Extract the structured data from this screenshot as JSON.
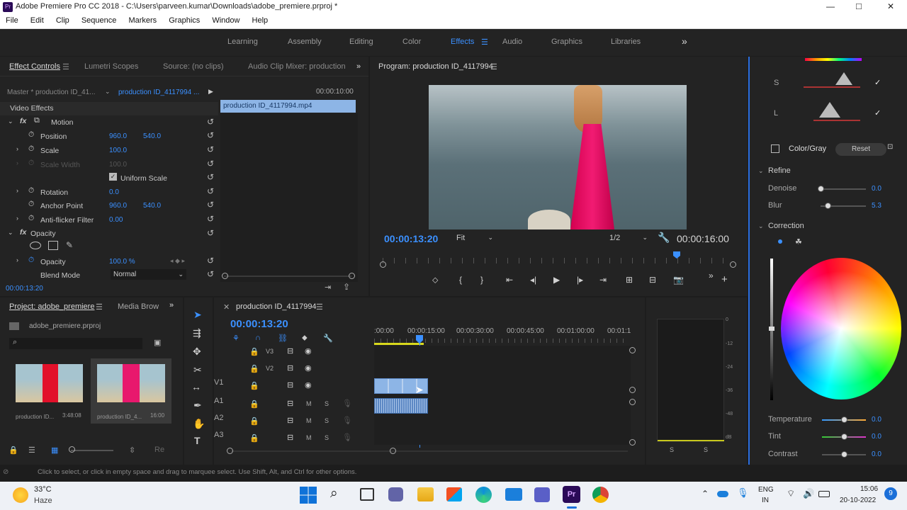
{
  "window": {
    "title": "Adobe Premiere Pro CC 2018 - C:\\Users\\parveen.kumar\\Downloads\\adobe_premiere.prproj *",
    "controls": [
      "—",
      "□",
      "✕"
    ]
  },
  "menu": [
    "File",
    "Edit",
    "Clip",
    "Sequence",
    "Markers",
    "Graphics",
    "Window",
    "Help"
  ],
  "workspaces": {
    "items": [
      "Learning",
      "Assembly",
      "Editing",
      "Color",
      "Effects",
      "Audio",
      "Graphics",
      "Libraries"
    ],
    "active": "Effects",
    "more": "»"
  },
  "effect_controls": {
    "tabs": [
      "Effect Controls",
      "Lumetri Scopes",
      "Source: (no clips)",
      "Audio Clip Mixer: production"
    ],
    "master": "Master * production ID_41...",
    "clip": "production ID_4117994 ...",
    "timecode_ruler": "00:00:10:00",
    "clip_bar": "production ID_4117994.mp4",
    "video_effects_label": "Video Effects",
    "motion_label": "Motion",
    "position_label": "Position",
    "position_x": "960.0",
    "position_y": "540.0",
    "scale_label": "Scale",
    "scale_val": "100.0",
    "scale_width_label": "Scale Width",
    "scale_width_val": "100.0",
    "uniform_scale_label": "Uniform Scale",
    "rotation_label": "Rotation",
    "rotation_val": "0.0",
    "anchor_label": "Anchor Point",
    "anchor_x": "960.0",
    "anchor_y": "540.0",
    "antiflicker_label": "Anti-flicker Filter",
    "antiflicker_val": "0.00",
    "opacity_label": "Opacity",
    "opacity_row_label": "Opacity",
    "opacity_val": "100.0 %",
    "blend_label": "Blend Mode",
    "blend_val": "Normal",
    "bottom_timecode": "00:00:13:20"
  },
  "program": {
    "title": "Program: production ID_4117994",
    "timecode": "00:00:13:20",
    "fit": "Fit",
    "resolution": "1/2",
    "duration": "00:00:16:00"
  },
  "project": {
    "tabs": [
      "Project: adobe_premiere",
      "Media Brow"
    ],
    "file": "adobe_premiere.prproj",
    "items": [
      {
        "name": "production ID...",
        "duration": "3:48:08"
      },
      {
        "name": "production ID_4...",
        "duration": "16:00"
      }
    ]
  },
  "timeline": {
    "title": "production ID_4117994",
    "timecode": "00:00:13:20",
    "ruler": [
      ":00:00",
      "00:00:15:00",
      "00:00:30:00",
      "00:00:45:00",
      "00:01:00:00",
      "00:01:1"
    ],
    "video_tracks": [
      "V3",
      "V2",
      "V1"
    ],
    "audio_tracks": [
      "A1",
      "A2",
      "A3"
    ],
    "track_m": "M",
    "track_s": "S"
  },
  "audio_meter": {
    "scale": [
      "0",
      "-12",
      "-24",
      "-36",
      "-48",
      "dB"
    ],
    "channels": [
      "S",
      "S"
    ]
  },
  "lumetri": {
    "s_label": "S",
    "l_label": "L",
    "color_gray": "Color/Gray",
    "reset": "Reset",
    "refine": "Refine",
    "denoise_label": "Denoise",
    "denoise_val": "0.0",
    "blur_label": "Blur",
    "blur_val": "5.3",
    "correction": "Correction",
    "temperature_label": "Temperature",
    "temperature_val": "0.0",
    "tint_label": "Tint",
    "tint_val": "0.0",
    "contrast_label": "Contrast",
    "contrast_val": "0.0"
  },
  "status": "Click to select, or click in empty space and drag to marquee select. Use Shift, Alt, and Ctrl for other options.",
  "taskbar": {
    "weather_temp": "33°C",
    "weather_desc": "Haze",
    "lang_top": "ENG",
    "lang_bottom": "IN",
    "time": "15:06",
    "date": "20-10-2022",
    "notif_count": "9"
  },
  "colors": {
    "accent_blue": "#3b90ff",
    "lumetri_pink": "#e0186c",
    "clip_blue": "#8db5e6"
  }
}
